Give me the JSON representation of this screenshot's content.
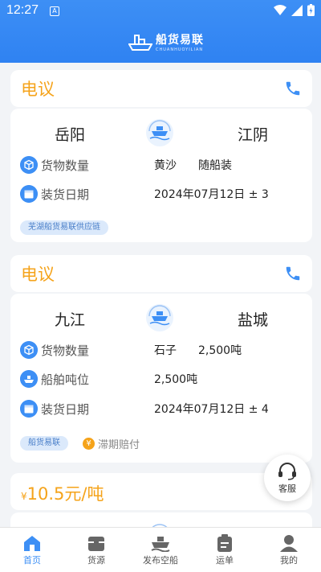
{
  "status": {
    "time": "12:27",
    "app_icon": "A"
  },
  "header": {
    "title": "船货易联",
    "subtitle": "CHUANHUOYILIAN"
  },
  "listings": [
    {
      "tag": "电议",
      "from": "岳阳",
      "to": "江阴",
      "rows": [
        {
          "label": "货物数量",
          "value1": "黄沙",
          "value2": "随船装"
        },
        {
          "label": "装货日期",
          "value1": "2024年07月12日 ± 3",
          "value2": ""
        }
      ],
      "chip": "芜湖船货易联供应链"
    },
    {
      "tag": "电议",
      "from": "九江",
      "to": "盐城",
      "rows": [
        {
          "label": "货物数量",
          "value1": "石子",
          "value2": "2,500吨"
        },
        {
          "label": "船舶吨位",
          "value1": "2,500吨",
          "value2": ""
        },
        {
          "label": "装货日期",
          "value1": "2024年07月12日 ± 4",
          "value2": ""
        }
      ],
      "chip": "船货易联",
      "guarantee_icon": "¥",
      "guarantee": "滞期赔付"
    },
    {
      "price_symbol": "¥",
      "price": "10.5元/吨"
    }
  ],
  "customer_service": "客服",
  "tabs": [
    {
      "label": "首页",
      "icon": "home-icon"
    },
    {
      "label": "货源",
      "icon": "cargo-icon"
    },
    {
      "label": "发布空船",
      "icon": "ship-icon"
    },
    {
      "label": "运单",
      "icon": "waybill-icon"
    },
    {
      "label": "我的",
      "icon": "profile-icon"
    }
  ],
  "colors": {
    "primary": "#3d8ff5",
    "accent": "#f5a31a"
  }
}
